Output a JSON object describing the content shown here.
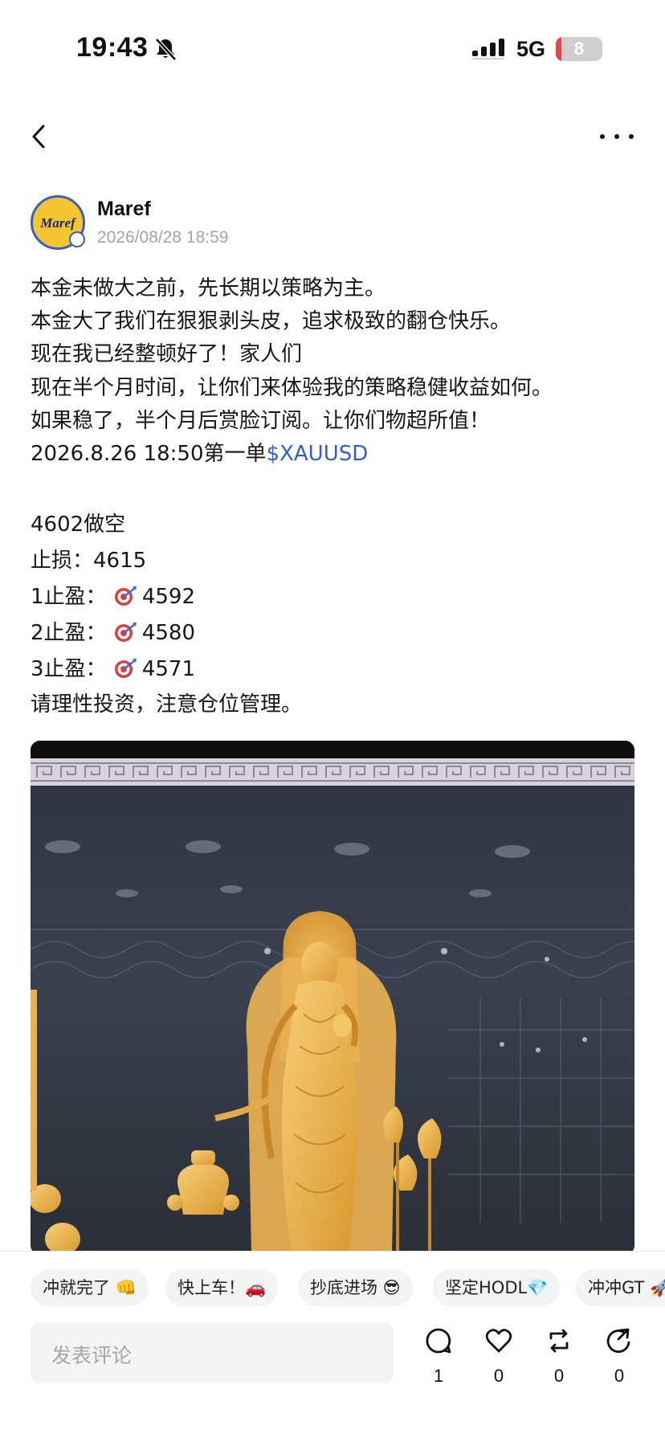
{
  "status_bar": {
    "time": "19:43",
    "network": "5G",
    "battery": "8",
    "battery_level": 0.08,
    "mute_icon": "bell-slash-icon",
    "signal_icon": "cellular-signal-icon"
  },
  "nav": {
    "back_icon": "chevron-left-icon",
    "more_icon": "ellipsis-icon"
  },
  "author": {
    "name": "Maref",
    "avatar_text": "Maref",
    "post_time": "2026/08/28 18:59"
  },
  "post": {
    "lines": [
      "本金未做大之前，先长期以策略为主。",
      "本金大了我们在狠狠剥头皮，追求极致的翻仓快乐。",
      "现在我已经整顿好了！家人们",
      "现在半个月时间，让你们来体验我的策略稳健收益如何。",
      "如果稳了，半个月后赏脸订阅。让你们物超所值！"
    ],
    "order_prefix": "2026.8.26  18:50第一单",
    "ticker": "$XAUUSD",
    "direction": "4602做空",
    "stop_loss": "止损：4615",
    "tp1_label": "1止盈：",
    "tp1_value": "4592",
    "tp2_label": "2止盈：",
    "tp2_value": "4580",
    "tp3_label": "3止盈：",
    "tp3_value": "4571",
    "disclaimer": "请理性投资，注意仓位管理。",
    "target_icon": "target-dart-icon",
    "image_subject": "golden-buddha-statue-photo"
  },
  "reactions": [
    "冲就完了 👊",
    "快上车！🚗",
    "抄底进场 😎",
    "坚定HODL💎",
    "冲冲GT 🚀"
  ],
  "comment": {
    "placeholder": "发表评论"
  },
  "actions": {
    "comments": "1",
    "likes": "0",
    "reposts": "0",
    "shares": "0"
  },
  "colors": {
    "ticker": "#2a5fd6",
    "battery_low": "#e8424a",
    "timestamp": "#a4a4a4",
    "chip_bg": "#f2f3f5"
  }
}
